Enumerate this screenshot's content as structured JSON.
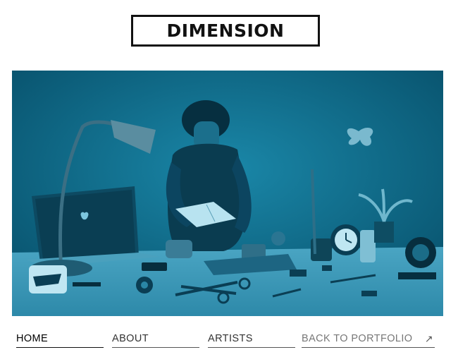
{
  "header": {
    "logo_text": "DIMENSION"
  },
  "hero": {
    "image_tint": "#0b6c8c"
  },
  "nav": {
    "items": [
      {
        "label": "HOME",
        "active": true
      },
      {
        "label": "ABOUT",
        "active": false
      },
      {
        "label": "ARTISTS",
        "active": false
      },
      {
        "label": "BACK TO PORTFOLIO",
        "active": false,
        "icon": "arrow-up-right-icon"
      }
    ],
    "back_arrow": "↗"
  },
  "colors": {
    "text": "#111111",
    "hero_blue": "#0b6c8c",
    "hero_dark": "#053446",
    "hero_light": "#5fb3cf"
  }
}
